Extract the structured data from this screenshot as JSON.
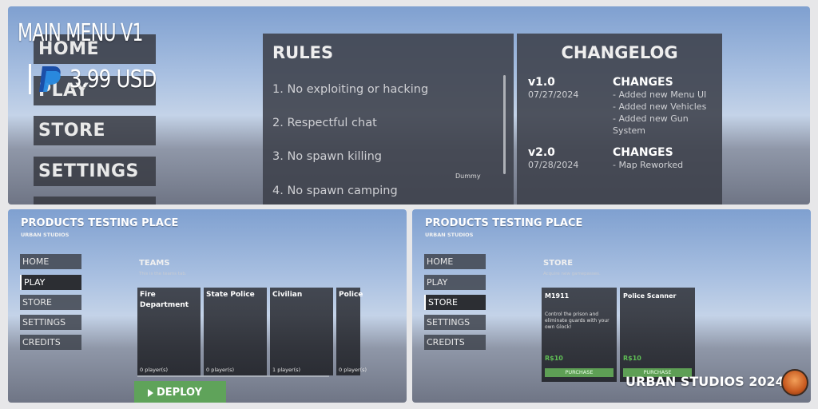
{
  "top": {
    "overlay_title": "MAIN MENU V1",
    "price": "3.99 USD",
    "menu": [
      {
        "label": "HOME"
      },
      {
        "label": "PLAY"
      },
      {
        "label": "STORE"
      },
      {
        "label": "SETTINGS"
      }
    ],
    "rules": {
      "title": "RULES",
      "items": [
        "1. No exploiting or hacking",
        "2. Respectful chat",
        "3. No spawn killing",
        "4. No spawn camping"
      ],
      "dummy_label": "Dummy"
    },
    "changelog": {
      "title": "CHANGELOG",
      "entries": [
        {
          "version": "v1.0",
          "date": "07/27/2024",
          "heading": "CHANGES",
          "changes": [
            "- Added new Menu UI",
            "- Added new Vehicles",
            "- Added new Gun System"
          ]
        },
        {
          "version": "v2.0",
          "date": "07/28/2024",
          "heading": "CHANGES",
          "changes": [
            "- Map Reworked"
          ]
        }
      ]
    }
  },
  "left_screen": {
    "title": "PRODUCTS TESTING PLACE",
    "subtitle": "URBAN STUDIOS",
    "nav": [
      "HOME",
      "PLAY",
      "STORE",
      "SETTINGS",
      "CREDITS"
    ],
    "active_nav": "PLAY",
    "section_title": "TEAMS",
    "section_sub": "This is the teams tab.",
    "teams": [
      {
        "name": "Fire Department",
        "players": "0 player(s)"
      },
      {
        "name": "State Police",
        "players": "0 player(s)"
      },
      {
        "name": "Civilian",
        "players": "1 player(s)"
      },
      {
        "name": "Police",
        "players": "0 player(s)"
      }
    ],
    "deploy_label": "DEPLOY"
  },
  "right_screen": {
    "title": "PRODUCTS TESTING PLACE",
    "subtitle": "URBAN STUDIOS",
    "nav": [
      "HOME",
      "PLAY",
      "STORE",
      "SETTINGS",
      "CREDITS"
    ],
    "active_nav": "STORE",
    "section_title": "STORE",
    "section_sub": "Acquire new gamepasses.",
    "items": [
      {
        "name": "M1911",
        "desc": "Control the prison and eliminate guards with your own Glock!",
        "price": "R$10",
        "button": "PURCHASE"
      },
      {
        "name": "Police Scanner",
        "desc": "",
        "price": "R$10",
        "button": "PURCHASE"
      }
    ]
  },
  "footer": {
    "text": "URBAN STUDIOS 2024"
  },
  "colors": {
    "accent_green": "#5fa35a",
    "panel": "#3c404a",
    "price_green": "#5fbf55"
  },
  "icons": [
    "paypal-icon",
    "play-arrow-icon",
    "urban-studios-logo"
  ]
}
